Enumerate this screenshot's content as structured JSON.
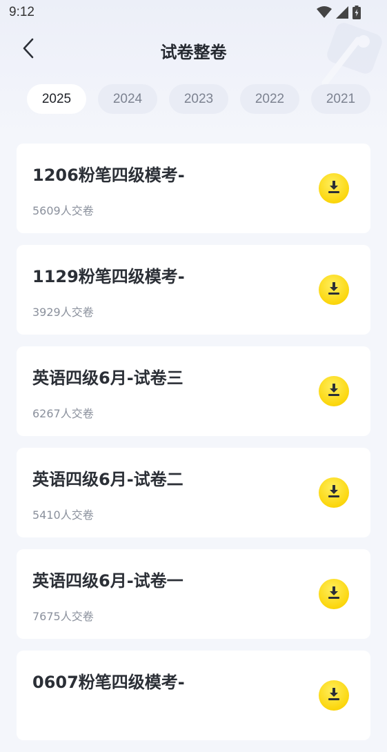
{
  "status_bar": {
    "time": "9:12",
    "icons": [
      "wifi-icon",
      "signal-icon",
      "battery-icon"
    ]
  },
  "header": {
    "title": "试卷整卷",
    "back_icon": "back-arrow-icon"
  },
  "year_tabs": [
    {
      "label": "2025",
      "active": true
    },
    {
      "label": "2024",
      "active": false
    },
    {
      "label": "2023",
      "active": false
    },
    {
      "label": "2022",
      "active": false
    },
    {
      "label": "2021",
      "active": false
    }
  ],
  "papers": [
    {
      "title": "1206粉笔四级模考-",
      "submitted": "5609人交卷"
    },
    {
      "title": "1129粉笔四级模考-",
      "submitted": "3929人交卷"
    },
    {
      "title": "英语四级6月-试卷三",
      "submitted": "6267人交卷"
    },
    {
      "title": "英语四级6月-试卷二",
      "submitted": "5410人交卷"
    },
    {
      "title": "英语四级6月-试卷一",
      "submitted": "7675人交卷"
    },
    {
      "title": "0607粉笔四级模考-",
      "submitted": ""
    }
  ],
  "colors": {
    "background": "#f4f6fb",
    "accent_yellow": "#fbd60d",
    "tab_active_bg": "#ffffff",
    "tab_inactive_bg": "#e9ecf5"
  }
}
